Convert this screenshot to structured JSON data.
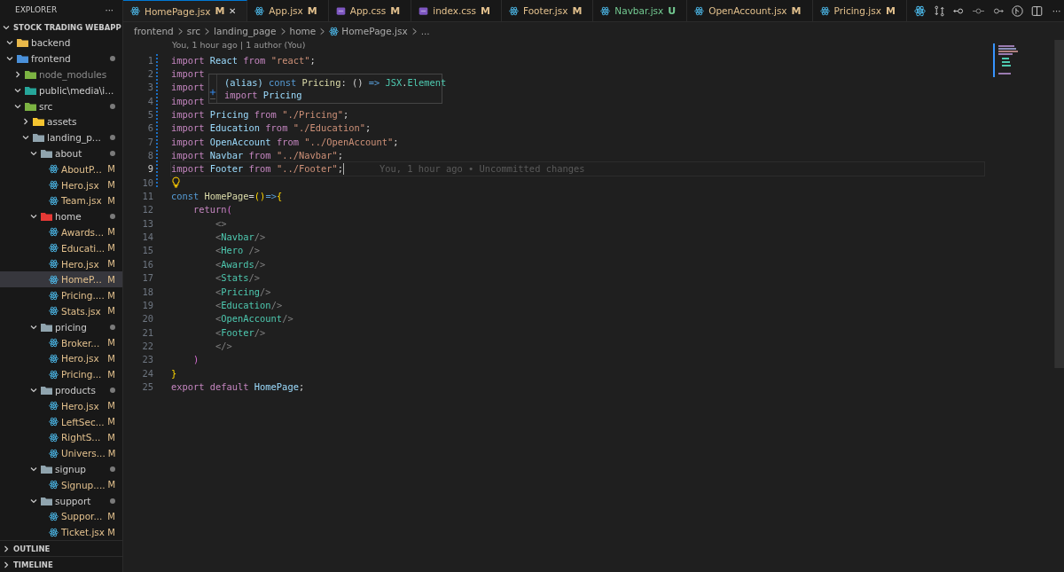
{
  "explorer": {
    "title": "EXPLORER",
    "more": "···",
    "project": "STOCK TRADING WEBAPP",
    "project_expanded": true,
    "tree": [
      {
        "name": "backend",
        "kind": "folder",
        "color": "#e8b84a",
        "expanded": true,
        "dot": false,
        "ignored": false,
        "selected": false
      },
      {
        "name": "frontend",
        "kind": "folder",
        "color": "#4a90d9",
        "expanded": true,
        "dot": true,
        "ignored": false,
        "selected": false,
        "children": [
          {
            "name": "node_modules",
            "kind": "folder",
            "color": "#7cb342",
            "expanded": false,
            "dot": false,
            "ignored": true,
            "selected": false
          },
          {
            "name": "public\\media\\i...",
            "kind": "folder",
            "color": "#26a69a",
            "expanded": true,
            "dot": false,
            "ignored": false,
            "selected": false
          },
          {
            "name": "src",
            "kind": "folder",
            "color": "#7cb342",
            "expanded": true,
            "dot": true,
            "ignored": false,
            "selected": false,
            "children": [
              {
                "name": "assets",
                "kind": "folder",
                "color": "#f4c430",
                "expanded": false,
                "dot": false,
                "ignored": false,
                "selected": false
              },
              {
                "name": "landing_p...",
                "kind": "folder",
                "color": "#90a4ae",
                "expanded": true,
                "dot": true,
                "ignored": false,
                "selected": false,
                "children": [
                  {
                    "name": "about",
                    "kind": "folder",
                    "color": "#90a4ae",
                    "expanded": true,
                    "dot": true,
                    "ignored": false,
                    "selected": false,
                    "children": [
                      {
                        "name": "AboutP...",
                        "kind": "file",
                        "badge": "M",
                        "selected": false
                      },
                      {
                        "name": "Hero.jsx",
                        "kind": "file",
                        "badge": "M",
                        "selected": false
                      },
                      {
                        "name": "Team.jsx",
                        "kind": "file",
                        "badge": "M",
                        "selected": false
                      }
                    ]
                  },
                  {
                    "name": "home",
                    "kind": "folder",
                    "color": "#e53935",
                    "expanded": true,
                    "dot": true,
                    "ignored": false,
                    "selected": false,
                    "children": [
                      {
                        "name": "Awards...",
                        "kind": "file",
                        "badge": "M",
                        "selected": false
                      },
                      {
                        "name": "Educati...",
                        "kind": "file",
                        "badge": "M",
                        "selected": false
                      },
                      {
                        "name": "Hero.jsx",
                        "kind": "file",
                        "badge": "M",
                        "selected": false
                      },
                      {
                        "name": "HomeP...",
                        "kind": "file",
                        "badge": "M",
                        "selected": true
                      },
                      {
                        "name": "Pricing....",
                        "kind": "file",
                        "badge": "M",
                        "selected": false
                      },
                      {
                        "name": "Stats.jsx",
                        "kind": "file",
                        "badge": "M",
                        "selected": false
                      }
                    ]
                  },
                  {
                    "name": "pricing",
                    "kind": "folder",
                    "color": "#90a4ae",
                    "expanded": true,
                    "dot": true,
                    "ignored": false,
                    "selected": false,
                    "children": [
                      {
                        "name": "Broker...",
                        "kind": "file",
                        "badge": "M",
                        "selected": false
                      },
                      {
                        "name": "Hero.jsx",
                        "kind": "file",
                        "badge": "M",
                        "selected": false
                      },
                      {
                        "name": "Pricing...",
                        "kind": "file",
                        "badge": "M",
                        "selected": false
                      }
                    ]
                  },
                  {
                    "name": "products",
                    "kind": "folder",
                    "color": "#90a4ae",
                    "expanded": true,
                    "dot": true,
                    "ignored": false,
                    "selected": false,
                    "children": [
                      {
                        "name": "Hero.jsx",
                        "kind": "file",
                        "badge": "M",
                        "selected": false
                      },
                      {
                        "name": "LeftSec...",
                        "kind": "file",
                        "badge": "M",
                        "selected": false
                      },
                      {
                        "name": "RightS...",
                        "kind": "file",
                        "badge": "M",
                        "selected": false
                      },
                      {
                        "name": "Univers...",
                        "kind": "file",
                        "badge": "M",
                        "selected": false
                      }
                    ]
                  },
                  {
                    "name": "signup",
                    "kind": "folder",
                    "color": "#90a4ae",
                    "expanded": true,
                    "dot": true,
                    "ignored": false,
                    "selected": false,
                    "children": [
                      {
                        "name": "Signup....",
                        "kind": "file",
                        "badge": "M",
                        "selected": false
                      }
                    ]
                  },
                  {
                    "name": "support",
                    "kind": "folder",
                    "color": "#90a4ae",
                    "expanded": true,
                    "dot": true,
                    "ignored": false,
                    "selected": false,
                    "children": [
                      {
                        "name": "Suppor...",
                        "kind": "file",
                        "badge": "M",
                        "selected": false
                      },
                      {
                        "name": "Ticket.jsx",
                        "kind": "file",
                        "badge": "M",
                        "selected": false
                      }
                    ]
                  }
                ]
              }
            ]
          }
        ]
      }
    ],
    "sections": [
      {
        "label": "OUTLINE",
        "expanded": false
      },
      {
        "label": "TIMELINE",
        "expanded": false
      }
    ]
  },
  "tabs": [
    {
      "label": "HomePage.jsx",
      "kind": "jsx",
      "badge": "M",
      "color": "#e2c08d",
      "selected": true,
      "close": "✕"
    },
    {
      "label": "App.jsx",
      "kind": "jsx",
      "badge": "M",
      "color": "#e2c08d",
      "selected": false
    },
    {
      "label": "App.css",
      "kind": "css",
      "badge": "M",
      "color": "#e2c08d",
      "selected": false
    },
    {
      "label": "index.css",
      "kind": "css",
      "badge": "M",
      "color": "#e2c08d",
      "selected": false
    },
    {
      "label": "Footer.jsx",
      "kind": "jsx",
      "badge": "M",
      "color": "#e2c08d",
      "selected": false
    },
    {
      "label": "Navbar.jsx",
      "kind": "jsx",
      "badge": "U",
      "color": "#73c991",
      "selected": false
    },
    {
      "label": "OpenAccount.jsx",
      "kind": "jsx",
      "badge": "M",
      "color": "#e2c08d",
      "selected": false
    },
    {
      "label": "Pricing.jsx",
      "kind": "jsx",
      "badge": "M",
      "color": "#e2c08d",
      "selected": false
    }
  ],
  "toolbar_more": "···",
  "breadcrumbs": [
    "frontend",
    "src",
    "landing_page",
    "home",
    "HomePage.jsx",
    "..."
  ],
  "codelens": "You, 1 hour ago | 1 author (You)",
  "lines": [
    {
      "n": "1",
      "active": false,
      "bulb": false,
      "tokens": [
        {
          "t": "import ",
          "kind": "kw"
        },
        {
          "t": "React ",
          "kind": "var"
        },
        {
          "t": "from ",
          "kind": "kw"
        },
        {
          "t": "\"react\"",
          "kind": "str"
        },
        {
          "t": ";",
          "kind": "punct"
        }
      ]
    },
    {
      "n": "2",
      "active": false,
      "bulb": false,
      "tokens": [
        {
          "t": "import",
          "kind": "kw"
        }
      ]
    },
    {
      "n": "3",
      "active": false,
      "bulb": false,
      "tokens": [
        {
          "t": "import",
          "kind": "kw"
        }
      ]
    },
    {
      "n": "4",
      "active": false,
      "bulb": false,
      "tokens": [
        {
          "t": "import",
          "kind": "kw"
        }
      ]
    },
    {
      "n": "5",
      "active": false,
      "bulb": false,
      "tokens": [
        {
          "t": "import ",
          "kind": "kw"
        },
        {
          "t": "Pricing ",
          "kind": "var"
        },
        {
          "t": "from ",
          "kind": "kw"
        },
        {
          "t": "\"./Pricing\"",
          "kind": "str"
        },
        {
          "t": ";",
          "kind": "punct"
        }
      ]
    },
    {
      "n": "6",
      "active": false,
      "bulb": false,
      "tokens": [
        {
          "t": "import ",
          "kind": "kw"
        },
        {
          "t": "Education ",
          "kind": "var"
        },
        {
          "t": "from ",
          "kind": "kw"
        },
        {
          "t": "\"./Education\"",
          "kind": "str"
        },
        {
          "t": ";",
          "kind": "punct"
        }
      ]
    },
    {
      "n": "7",
      "active": false,
      "bulb": false,
      "tokens": [
        {
          "t": "import ",
          "kind": "kw"
        },
        {
          "t": "OpenAccount ",
          "kind": "var"
        },
        {
          "t": "from ",
          "kind": "kw"
        },
        {
          "t": "\"../OpenAccount\"",
          "kind": "str"
        },
        {
          "t": ";",
          "kind": "punct"
        }
      ]
    },
    {
      "n": "8",
      "active": false,
      "bulb": false,
      "tokens": [
        {
          "t": "import ",
          "kind": "kw"
        },
        {
          "t": "Navbar ",
          "kind": "var"
        },
        {
          "t": "from ",
          "kind": "kw"
        },
        {
          "t": "\"../Navbar\"",
          "kind": "str"
        },
        {
          "t": ";",
          "kind": "punct"
        }
      ]
    },
    {
      "n": "9",
      "active": true,
      "bulb": false,
      "blame": "You, 1 hour ago • Uncommitted changes",
      "tokens": [
        {
          "t": "import ",
          "kind": "kw"
        },
        {
          "t": "Footer ",
          "kind": "var"
        },
        {
          "t": "from ",
          "kind": "kw"
        },
        {
          "t": "\"../Footer\"",
          "kind": "str"
        },
        {
          "t": ";",
          "kind": "punct"
        }
      ]
    },
    {
      "n": "10",
      "active": false,
      "bulb": true
    },
    {
      "n": "11",
      "active": false,
      "bulb": false,
      "tokens": [
        {
          "t": "const ",
          "kind": "decl"
        },
        {
          "t": "HomePage",
          "kind": "fn"
        },
        {
          "t": "=",
          "kind": "punct"
        },
        {
          "t": "()",
          "kind": "brace"
        },
        {
          "t": "=>",
          "kind": "decl"
        },
        {
          "t": "{",
          "kind": "brace"
        }
      ]
    },
    {
      "n": "12",
      "active": false,
      "bulb": false,
      "tokens": [
        {
          "t": "    return",
          "kind": "kw"
        },
        {
          "t": "(",
          "kind": "brace2"
        }
      ]
    },
    {
      "n": "13",
      "active": false,
      "bulb": false,
      "tokens": [
        {
          "t": "        <>",
          "kind": "tagp"
        }
      ]
    },
    {
      "n": "14",
      "active": false,
      "bulb": false,
      "tokens": [
        {
          "t": "        <",
          "kind": "tagp"
        },
        {
          "t": "Navbar",
          "kind": "tag"
        },
        {
          "t": "/>",
          "kind": "tagp"
        }
      ]
    },
    {
      "n": "15",
      "active": false,
      "bulb": false,
      "tokens": [
        {
          "t": "        <",
          "kind": "tagp"
        },
        {
          "t": "Hero ",
          "kind": "tag"
        },
        {
          "t": "/>",
          "kind": "tagp"
        }
      ]
    },
    {
      "n": "16",
      "active": false,
      "bulb": false,
      "tokens": [
        {
          "t": "        <",
          "kind": "tagp"
        },
        {
          "t": "Awards",
          "kind": "tag"
        },
        {
          "t": "/>",
          "kind": "tagp"
        }
      ]
    },
    {
      "n": "17",
      "active": false,
      "bulb": false,
      "tokens": [
        {
          "t": "        <",
          "kind": "tagp"
        },
        {
          "t": "Stats",
          "kind": "tag"
        },
        {
          "t": "/>",
          "kind": "tagp"
        }
      ]
    },
    {
      "n": "18",
      "active": false,
      "bulb": false,
      "tokens": [
        {
          "t": "        <",
          "kind": "tagp"
        },
        {
          "t": "Pricing",
          "kind": "tag"
        },
        {
          "t": "/>",
          "kind": "tagp"
        }
      ]
    },
    {
      "n": "19",
      "active": false,
      "bulb": false,
      "tokens": [
        {
          "t": "        <",
          "kind": "tagp"
        },
        {
          "t": "Education",
          "kind": "tag"
        },
        {
          "t": "/>",
          "kind": "tagp"
        }
      ]
    },
    {
      "n": "20",
      "active": false,
      "bulb": false,
      "tokens": [
        {
          "t": "        <",
          "kind": "tagp"
        },
        {
          "t": "OpenAccount",
          "kind": "tag"
        },
        {
          "t": "/>",
          "kind": "tagp"
        }
      ]
    },
    {
      "n": "21",
      "active": false,
      "bulb": false,
      "tokens": [
        {
          "t": "        <",
          "kind": "tagp"
        },
        {
          "t": "Footer",
          "kind": "tag"
        },
        {
          "t": "/>",
          "kind": "tagp"
        }
      ]
    },
    {
      "n": "22",
      "active": false,
      "bulb": false,
      "tokens": [
        {
          "t": "        </>",
          "kind": "tagp"
        }
      ]
    },
    {
      "n": "23",
      "active": false,
      "bulb": false,
      "tokens": [
        {
          "t": "    )",
          "kind": "brace2"
        }
      ]
    },
    {
      "n": "24",
      "active": false,
      "bulb": false,
      "tokens": [
        {
          "t": "}",
          "kind": "brace"
        }
      ]
    },
    {
      "n": "25",
      "active": false,
      "bulb": false,
      "tokens": [
        {
          "t": "export default ",
          "kind": "kw"
        },
        {
          "t": "HomePage",
          "kind": "var"
        },
        {
          "t": ";",
          "kind": "punct"
        }
      ]
    }
  ],
  "hover": {
    "lines": [
      [
        {
          "t": "(alias) ",
          "kind": "var"
        },
        {
          "t": "const ",
          "kind": "decl"
        },
        {
          "t": "Pricing",
          "kind": "fn"
        },
        {
          "t": ": () ",
          "kind": "punct"
        },
        {
          "t": "=> ",
          "kind": "decl"
        },
        {
          "t": "JSX",
          "kind": "tag"
        },
        {
          "t": ".",
          "kind": "punct"
        },
        {
          "t": "Element",
          "kind": "tag"
        }
      ],
      [
        {
          "t": "import ",
          "kind": "kw"
        },
        {
          "t": "Pricing",
          "kind": "var"
        }
      ]
    ]
  }
}
